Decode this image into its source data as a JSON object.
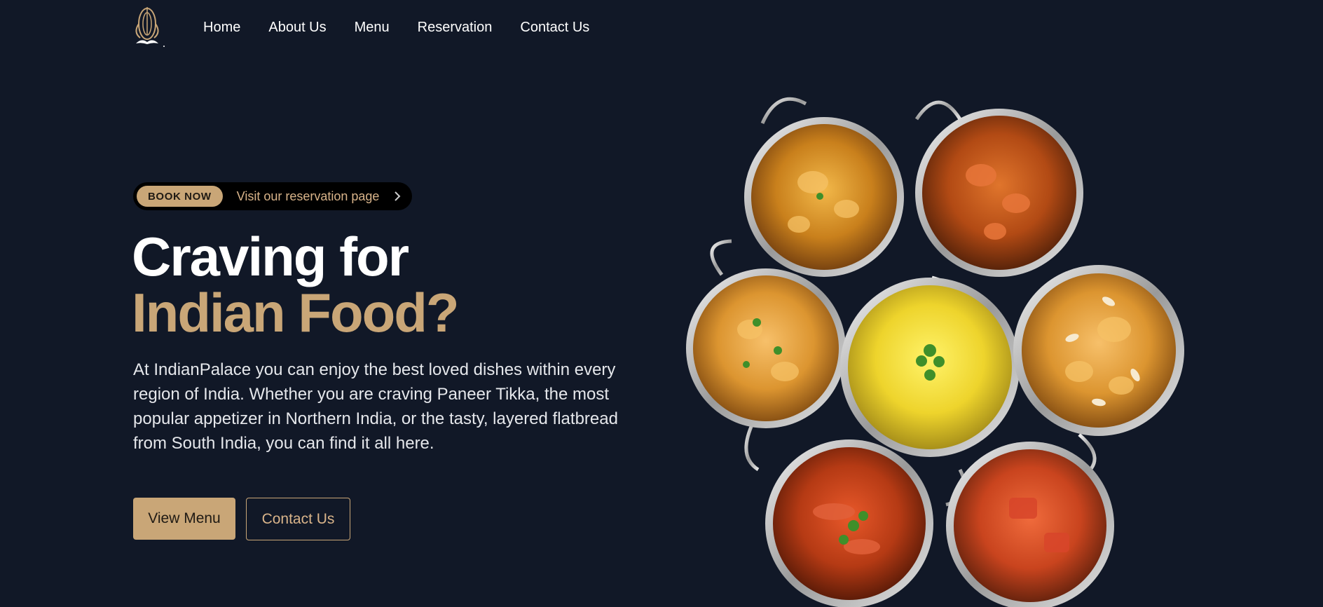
{
  "nav": {
    "logo": "indianpalace-logo",
    "links": [
      "Home",
      "About Us",
      "Menu",
      "Reservation",
      "Contact Us"
    ]
  },
  "hero": {
    "badge": "BOOK NOW",
    "badge_text": "Visit our reservation page",
    "title_line1": "Craving for",
    "title_line2": "Indian Food?",
    "description": "At IndianPalace you can enjoy the best loved dishes within every region of India. Whether you are craving Paneer Tikka, the most popular appetizer in Northern India, or the tasty, layered flatbread from South India, you can find it all here.",
    "primary_button": "View Menu",
    "secondary_button": "Contact Us"
  },
  "colors": {
    "background": "#111827",
    "accent": "#c9a677",
    "accent_text": "#d9b48a"
  },
  "icons": {
    "pill_arrow": "chevron-right-icon"
  }
}
